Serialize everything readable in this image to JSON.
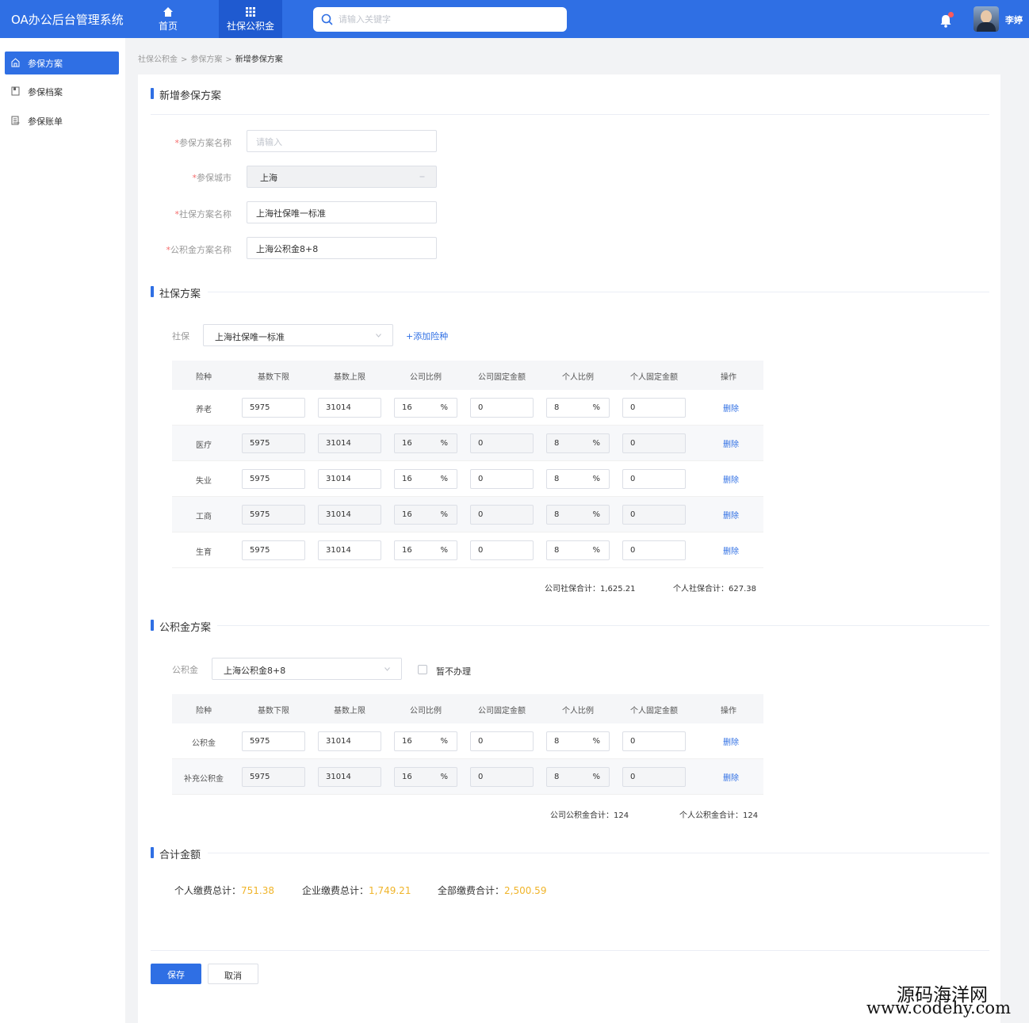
{
  "header": {
    "brand": "OA办公后台管理系统",
    "nav": [
      {
        "label": "首页"
      },
      {
        "label": "社保公积金"
      }
    ],
    "search_placeholder": "请输入关键字",
    "username": "李婷"
  },
  "sidebar": {
    "items": [
      {
        "label": "参保方案"
      },
      {
        "label": "参保档案"
      },
      {
        "label": "参保账单"
      }
    ]
  },
  "breadcrumb": [
    "社保公积金",
    "参保方案",
    "新增参保方案"
  ],
  "form": {
    "title": "新增参保方案",
    "fields": [
      {
        "label": "参保方案名称",
        "value": "",
        "placeholder": "请输入"
      },
      {
        "label": "参保城市",
        "value": "上海"
      },
      {
        "label": "社保方案名称",
        "value": "上海社保唯一标准"
      },
      {
        "label": "公积金方案名称",
        "value": "上海公积金8+8"
      }
    ]
  },
  "social": {
    "title": "社保方案",
    "select_label": "社保",
    "select_value": "上海社保唯一标准",
    "add_link": "+添加险种",
    "columns": [
      "险种",
      "基数下限",
      "基数上限",
      "公司比例",
      "公司固定金额",
      "个人比例",
      "个人固定金额",
      "操作"
    ],
    "rows": [
      {
        "name": "养老",
        "min": "5975",
        "max": "31014",
        "company_ratio": "16",
        "company_fixed": "0",
        "personal_ratio": "8",
        "personal_fixed": "0",
        "action": "删除"
      },
      {
        "name": "医疗",
        "min": "5975",
        "max": "31014",
        "company_ratio": "16",
        "company_fixed": "0",
        "personal_ratio": "8",
        "personal_fixed": "0",
        "action": "删除"
      },
      {
        "name": "失业",
        "min": "5975",
        "max": "31014",
        "company_ratio": "16",
        "company_fixed": "0",
        "personal_ratio": "8",
        "personal_fixed": "0",
        "action": "删除"
      },
      {
        "name": "工商",
        "min": "5975",
        "max": "31014",
        "company_ratio": "16",
        "company_fixed": "0",
        "personal_ratio": "8",
        "personal_fixed": "0",
        "action": "删除"
      },
      {
        "name": "生育",
        "min": "5975",
        "max": "31014",
        "company_ratio": "16",
        "company_fixed": "0",
        "personal_ratio": "8",
        "personal_fixed": "0",
        "action": "删除"
      }
    ],
    "pct_symbol": "%",
    "company_total_label": "公司社保合计：",
    "company_total": "1,625.21",
    "personal_total_label": "个人社保合计：",
    "personal_total": "627.38"
  },
  "fund": {
    "title": "公积金方案",
    "select_label": "公积金",
    "select_value": "上海公积金8+8",
    "checkbox_label": "暂不办理",
    "columns": [
      "险种",
      "基数下限",
      "基数上限",
      "公司比例",
      "公司固定金额",
      "个人比例",
      "个人固定金额",
      "操作"
    ],
    "rows": [
      {
        "name": "公积金",
        "min": "5975",
        "max": "31014",
        "company_ratio": "16",
        "company_fixed": "0",
        "personal_ratio": "8",
        "personal_fixed": "0",
        "action": "删除"
      },
      {
        "name": "补充公积金",
        "min": "5975",
        "max": "31014",
        "company_ratio": "16",
        "company_fixed": "0",
        "personal_ratio": "8",
        "personal_fixed": "0",
        "action": "删除"
      }
    ],
    "company_total_label": "公司公积金合计：",
    "company_total": "124",
    "personal_total_label": "个人公积金合计：",
    "personal_total": "124"
  },
  "totals": {
    "title": "合计金额",
    "personal_label": "个人缴费总计：",
    "personal_value": "751.38",
    "company_label": "企业缴费总计：",
    "company_value": "1,749.21",
    "all_label": "全部缴费合计：",
    "all_value": "2,500.59"
  },
  "actions": {
    "save": "保存",
    "cancel": "取消"
  },
  "watermark": {
    "line1": "源码海洋网",
    "line2": "www.codehy.com"
  },
  "colors": {
    "primary": "#2f6fe4",
    "highlight": "#f0b429",
    "required": "#f56c6c"
  }
}
